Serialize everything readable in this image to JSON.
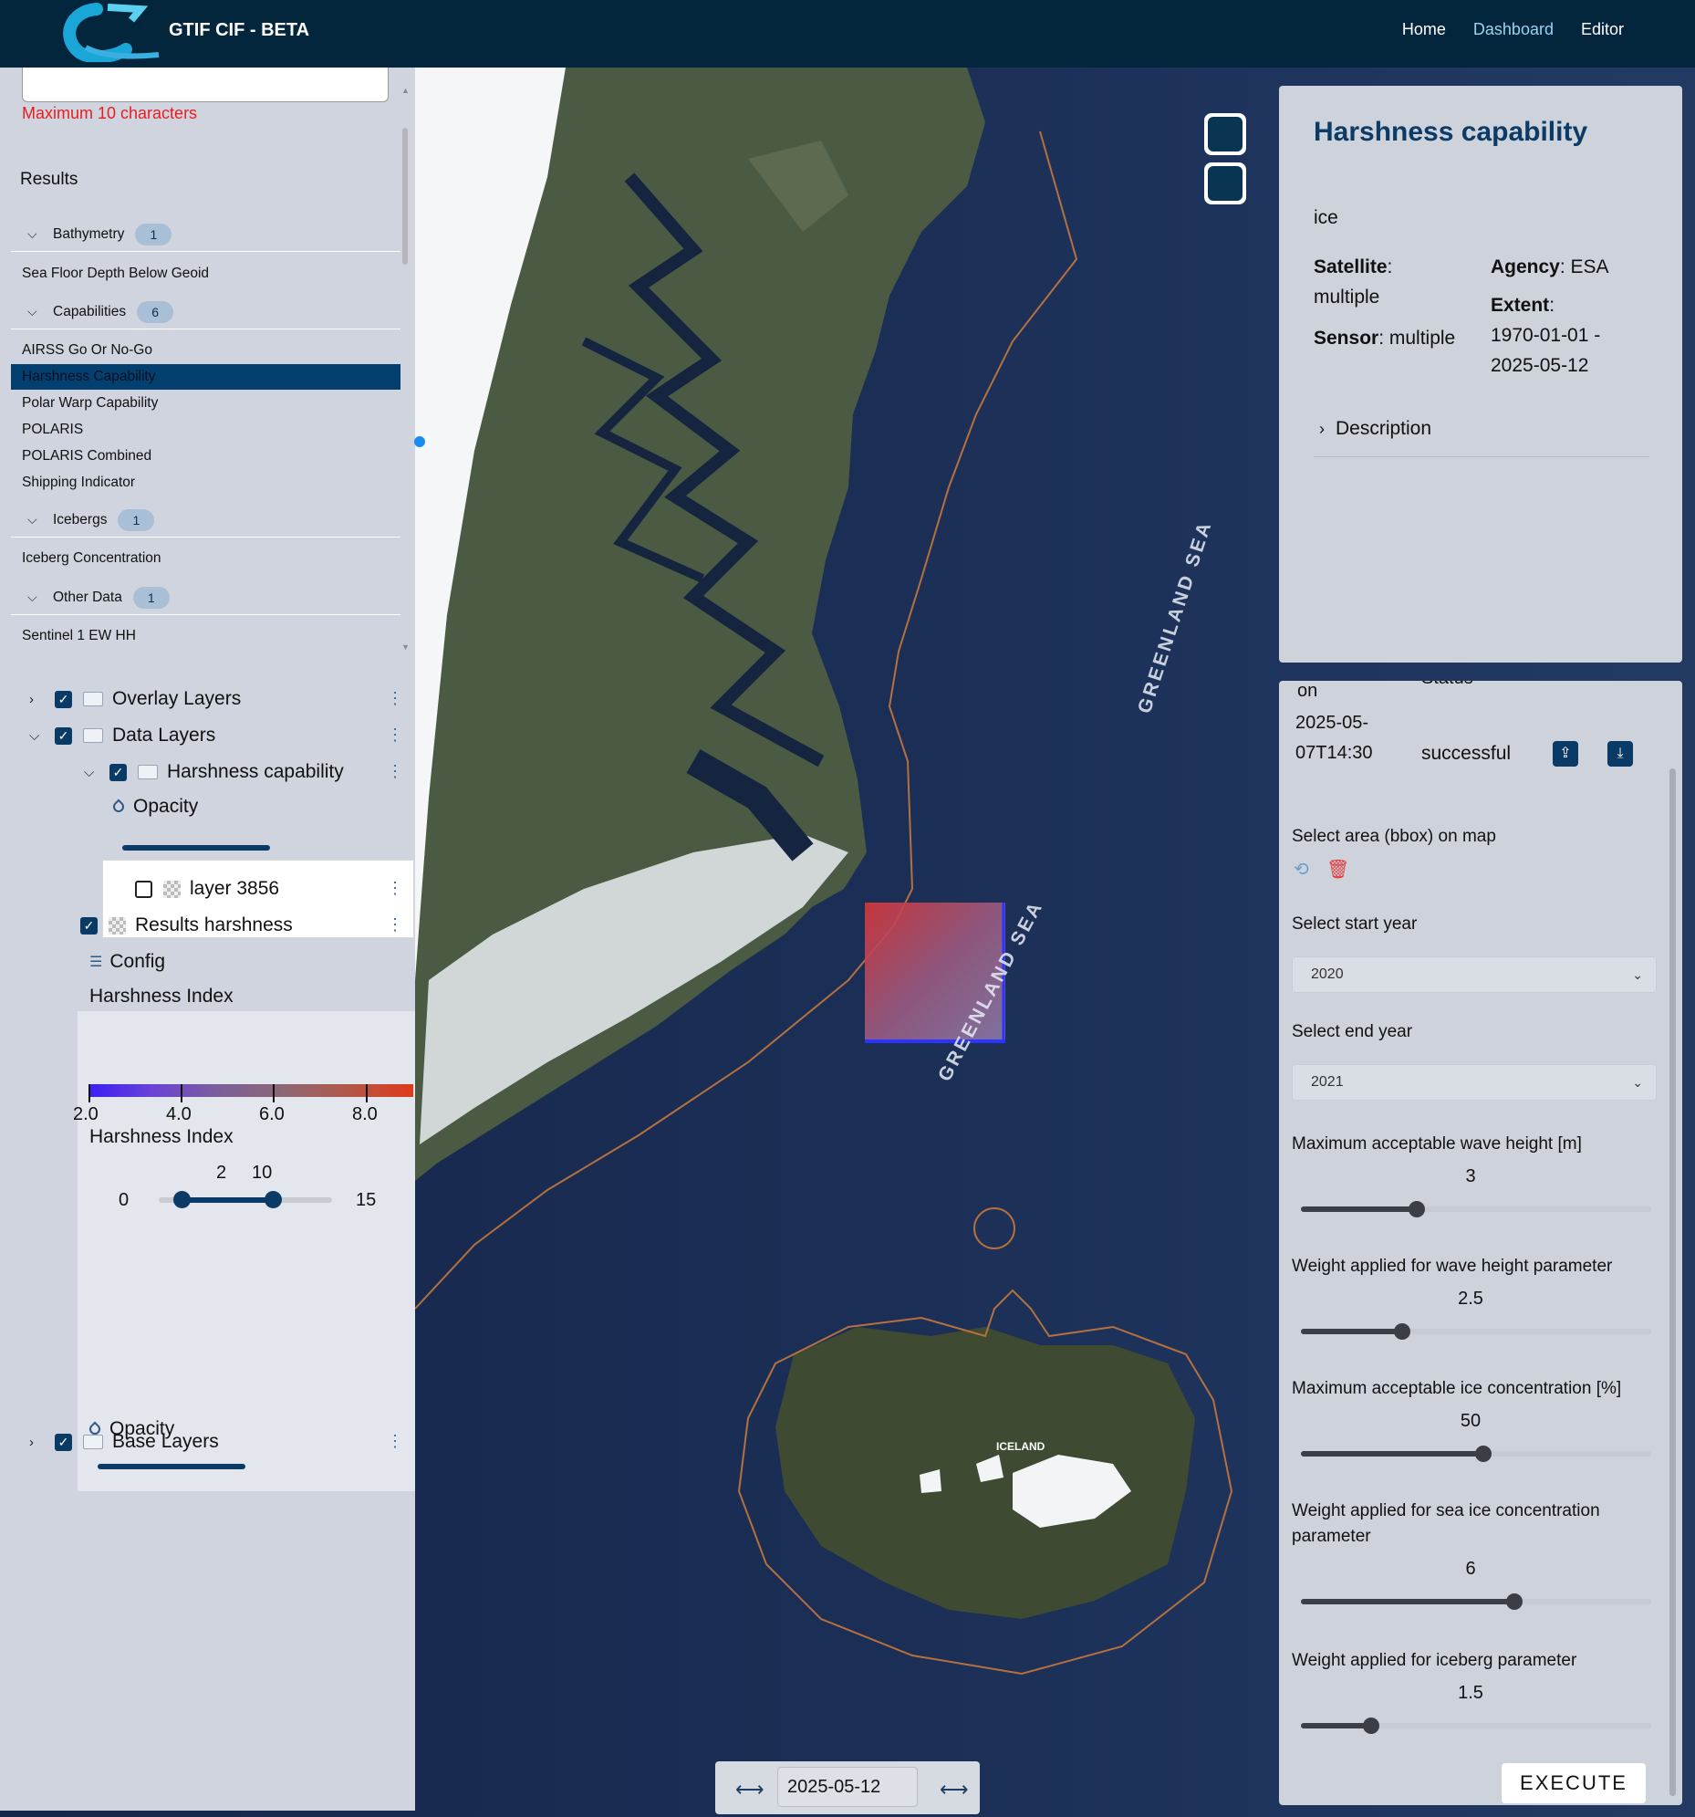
{
  "header": {
    "app_title": "GTIF CIF - BETA",
    "nav": [
      {
        "label": "Home"
      },
      {
        "label": "Dashboard"
      },
      {
        "label": "Editor"
      }
    ]
  },
  "left_panel": {
    "input_error": "Maximum 10 characters",
    "results_label": "Results",
    "groups": [
      {
        "name": "Bathymetry",
        "count": "1",
        "items": [
          "Sea Floor Depth Below Geoid"
        ]
      },
      {
        "name": "Capabilities",
        "count": "6",
        "items": [
          "AIRSS Go Or No-Go",
          "Harshness Capability",
          "Polar Warp Capability",
          "POLARIS",
          "POLARIS Combined",
          "Shipping Indicator"
        ]
      },
      {
        "name": "Icebergs",
        "count": "1",
        "items": [
          "Iceberg Concentration"
        ]
      },
      {
        "name": "Other Data",
        "count": "1",
        "items": [
          "Sentinel 1 EW HH"
        ]
      }
    ],
    "selected_item": "Harshness Capability",
    "layers": {
      "overlay": "Overlay Layers",
      "data": "Data Layers",
      "harshness_group": "Harshness capability",
      "opacity": "Opacity",
      "layer_3856": "layer 3856",
      "results_harshness": "Results harshness",
      "config": "Config",
      "legend_title": "Harshness Index",
      "legend_ticks": [
        "2.0",
        "4.0",
        "6.0",
        "8.0"
      ],
      "filter_title": "Harshness Index",
      "filter_min": "0",
      "filter_max": "15",
      "filter_low": "2",
      "filter_high": "10",
      "opacity2": "Opacity",
      "base": "Base Layers"
    }
  },
  "info_panel": {
    "title": "Harshness capability",
    "subtitle": "ice",
    "satellite_label": "Satellite",
    "satellite_value": "multiple",
    "agency_label": "Agency",
    "agency_value": "ESA",
    "sensor_label": "Sensor",
    "sensor_value": "multiple",
    "extent_label": "Extent",
    "extent_value": "1970-01-01 - 2025-05-12",
    "description_label": "Description"
  },
  "process_panel": {
    "col_on": "on",
    "col_status": "Status",
    "job_date": "2025-05-07T14:30",
    "job_status": "successful",
    "bbox_label": "Select area (bbox) on map",
    "start_year_label": "Select start year",
    "start_year_value": "2020",
    "end_year_label": "Select end year",
    "end_year_value": "2021",
    "params": [
      {
        "label": "Maximum acceptable wave height [m]",
        "value": "3",
        "fraction": 0.33
      },
      {
        "label": "Weight applied for wave height parameter",
        "value": "2.5",
        "fraction": 0.29
      },
      {
        "label": "Maximum acceptable ice concentration [%]",
        "value": "50",
        "fraction": 0.52
      },
      {
        "label": "Weight applied for sea ice concentration parameter",
        "value": "6",
        "fraction": 0.61
      },
      {
        "label": "Weight applied for iceberg parameter",
        "value": "1.5",
        "fraction": 0.2
      }
    ],
    "execute_label": "EXECUTE"
  },
  "map": {
    "sea_label_1": "GREENLAND SEA",
    "sea_label_2": "GREENLAND SEA",
    "island_label": "ICELAND"
  },
  "date_control": {
    "date": "2025-05-12"
  },
  "colors": {
    "header_bg": "#03263d",
    "accent": "#0a3a66",
    "error": "#e81e1e",
    "map_sea": "#1c2f55"
  }
}
